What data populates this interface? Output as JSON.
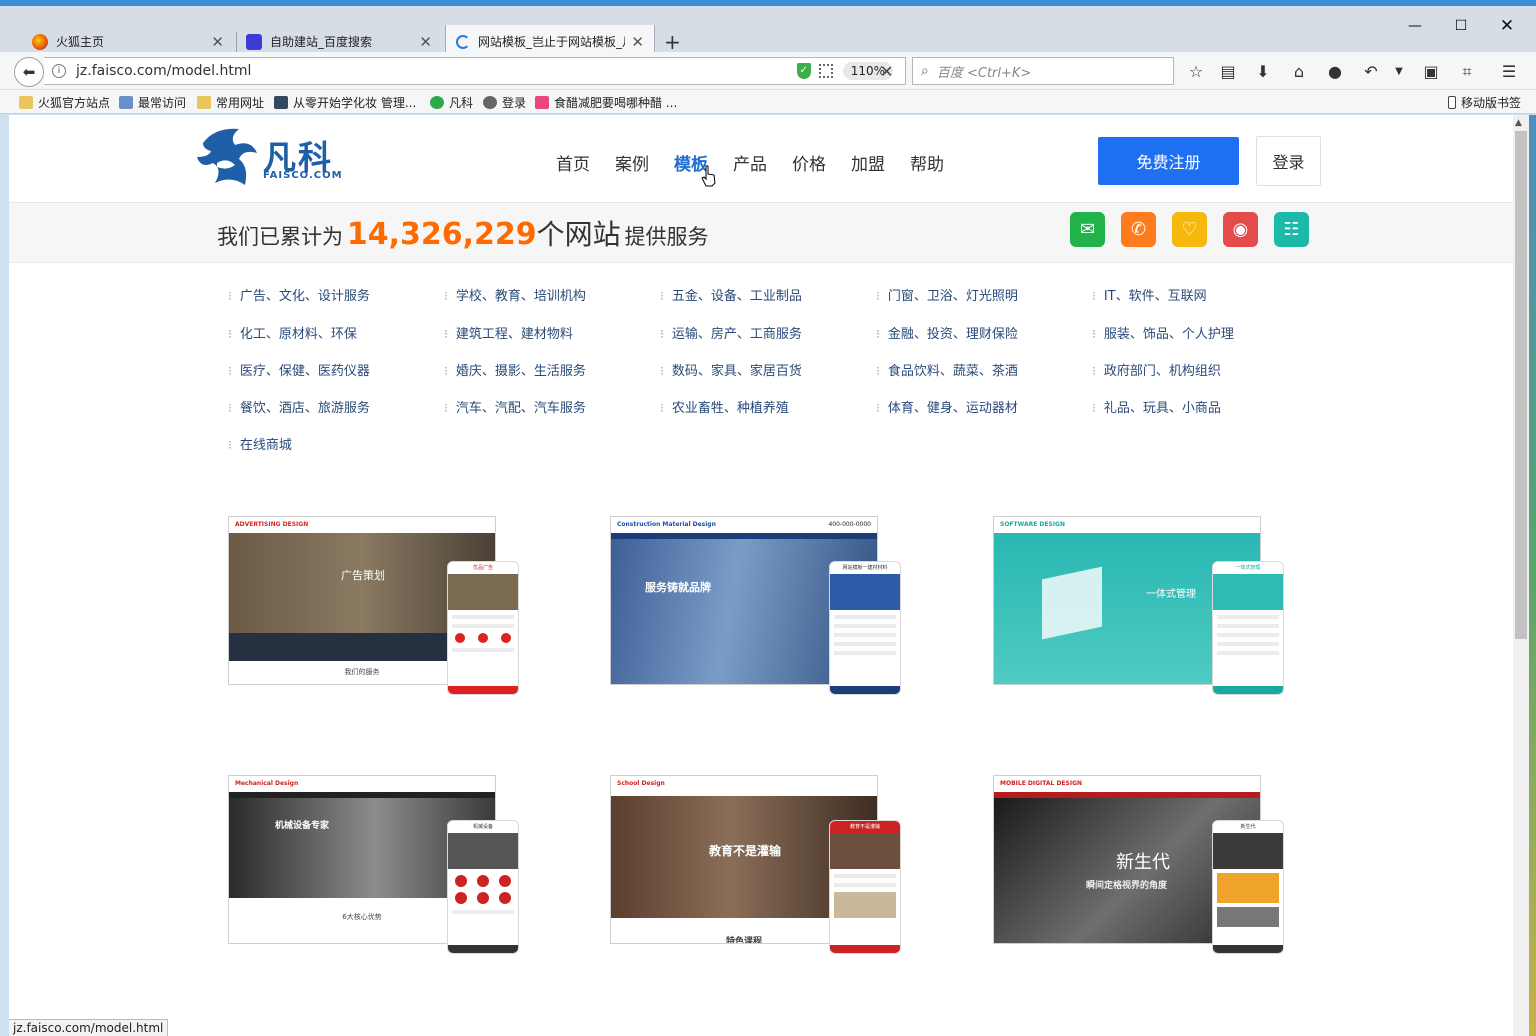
{
  "browser": {
    "tabs": [
      {
        "title": "火狐主页",
        "active": false
      },
      {
        "title": "自助建站_百度搜索",
        "active": false
      },
      {
        "title": "网站模板_岂止于网站模板_月",
        "active": true
      }
    ],
    "url": "jz.faisco.com/model.html",
    "zoom": "110%",
    "search_placeholder": "百度 <Ctrl+K>",
    "bookmarks": [
      "火狐官方站点",
      "最常访问",
      "常用网址",
      "从零开始学化妆 管理...",
      "凡科",
      "登录",
      "食醋减肥要喝哪种醋 ...",
      "移动版书签"
    ],
    "status_url": "jz.faisco.com/model.html"
  },
  "site": {
    "logo_text": "凡科",
    "logo_sub": "FAISCO.COM",
    "nav": [
      "首页",
      "案例",
      "模板",
      "产品",
      "价格",
      "加盟",
      "帮助"
    ],
    "nav_active_index": 2,
    "register_label": "免费注册",
    "login_label": "登录",
    "stats_pre": "我们已累计为",
    "stats_number": "14,326,229",
    "stats_unit": "个网站",
    "stats_post": "提供服务",
    "categories": [
      [
        "广告、文化、设计服务",
        "学校、教育、培训机构",
        "五金、设备、工业制品",
        "门窗、卫浴、灯光照明",
        "IT、软件、互联网"
      ],
      [
        "化工、原材料、环保",
        "建筑工程、建材物料",
        "运输、房产、工商服务",
        "金融、投资、理财保险",
        "服装、饰品、个人护理"
      ],
      [
        "医疗、保健、医药仪器",
        "婚庆、摄影、生活服务",
        "数码、家具、家居百货",
        "食品饮料、蔬菜、茶酒",
        "政府部门、机构组织"
      ],
      [
        "餐饮、酒店、旅游服务",
        "汽车、汽配、汽车服务",
        "农业畜牲、种植养殖",
        "体育、健身、运动器材",
        "礼品、玩具、小商品"
      ],
      [
        "在线商城"
      ]
    ],
    "templates": [
      {
        "brand": "ADVERTISING DESIGN",
        "hero": "广告策划",
        "foot": "我们的服务",
        "phone": "优品广告"
      },
      {
        "brand": "Construction Material Design",
        "phone_no": "400-000-0000",
        "hero": "服务铸就品牌",
        "phone": "网站模板一建材材料"
      },
      {
        "brand": "SOFTWARE DESIGN",
        "hero": "一体式管理",
        "phone": "一体式管理"
      },
      {
        "brand": "Mechanical Design",
        "hero": "机械设备专家",
        "foot": "6大核心优势",
        "phone": "机械设备"
      },
      {
        "brand": "School Design",
        "hero": "教育不是灌输",
        "foot": "特色课程",
        "phone": "教育不是灌输"
      },
      {
        "brand": "MOBILE DIGITAL DESIGN",
        "hero": "新生代",
        "sub": "瞬间定格视界的角度",
        "phone": "新生代"
      }
    ]
  },
  "colors": {
    "primary": "#1e6ff2",
    "accent_number": "#ff6a00",
    "nav_active": "#1f6fd3",
    "wechat": "#21b24b",
    "phone": "#ff7b1c",
    "heart": "#f7b80e",
    "weibo": "#e44b4b",
    "note": "#1cb8a8"
  },
  "icons": [
    "wechat-icon",
    "phone-icon",
    "heart-icon",
    "weibo-icon",
    "note-icon"
  ]
}
